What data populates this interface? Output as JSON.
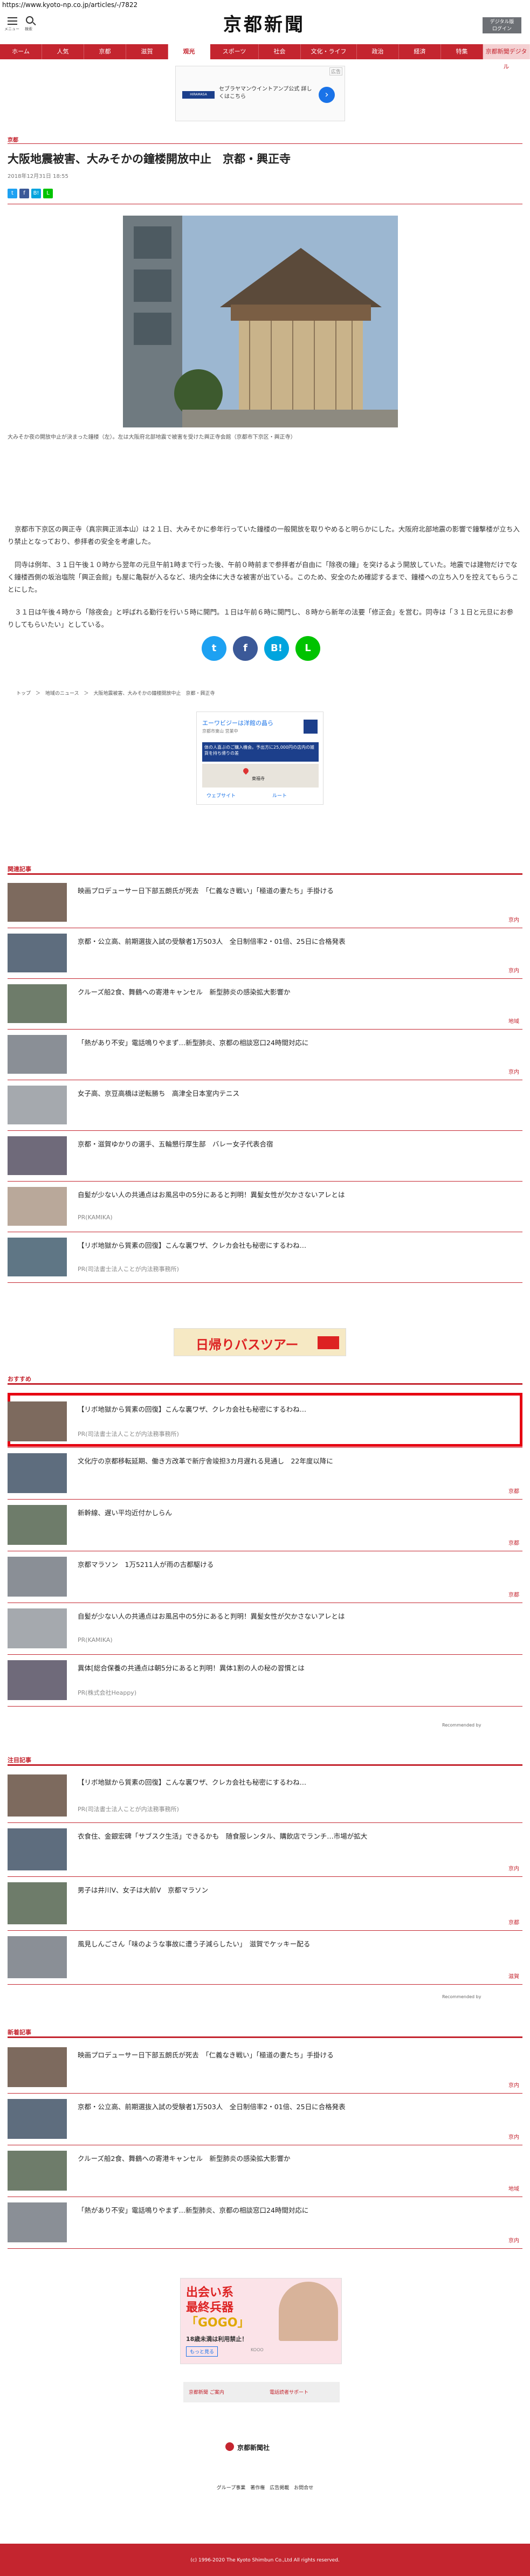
{
  "browser": {
    "url": "https://www.kyoto-np.co.jp/articles/-/7822"
  },
  "header": {
    "menu_label": "メニュー",
    "search_label": "検索",
    "logo": "京都新聞",
    "digital_button": "デジタル版\nログイン"
  },
  "nav": {
    "items": [
      {
        "label": "ホーム"
      },
      {
        "label": "人気"
      },
      {
        "label": "京都"
      },
      {
        "label": "滋賀"
      },
      {
        "label": "观光"
      },
      {
        "label": "スポーツ"
      },
      {
        "label": "社会"
      },
      {
        "label": "文化・ライフ"
      },
      {
        "label": "政治"
      },
      {
        "label": "経済"
      },
      {
        "label": "特集"
      },
      {
        "label": "京都新聞デジタル"
      }
    ]
  },
  "top_ad": {
    "tag": "広告",
    "brand": "HIRAMASA",
    "text": "セブラヤマンウイントアンプ公式 詳しくはこちら"
  },
  "article": {
    "section": "京都",
    "title": "大阪地震被害、大みそかの鐘楼開放中止　京都・興正寺",
    "date": "2018年12月31日 18:55",
    "caption": "大みそか夜の開放中止が決まった鐘楼（左）。左は大阪府北部地震で被害を受けた興正寺会館（京都市下京区・興正寺）",
    "paragraphs": [
      "京都市下京区の興正寺（真宗興正派本山）は２１日、大みそかに参年行っていた鐘楼の一般開放を取りやめると明らかにした。大阪府北部地震の影響で鐘撃楼が立ち入り禁止となっており、参拝者の安全を考慮した。",
      "同寺は例年、３１日午後１０時から翌年の元旦午前1時まで行った後、午前０時前まで参拝者が自由に「除夜の鐘」を突けるよう開放していた。地震では建物だけでなく鐘楼西側の坂治塩院「興正会館」も屋に亀裂が入るなど、境内全体に大きな被害が出ている。このため、安全のため確認するまで、鐘楼への立ち入りを控えてもらうことにした。",
      "３１日は午後４時から「除夜会」と呼ばれる勤行を行い５時に開門。１日は午前６時に開門し、８時から新年の法要「修正会」を営む。同寺は「３１日と元旦にお参りしてもらいたい」としている。"
    ],
    "breadcrumb": "トップ　＞　地域のニュース　＞　大阪地震被害、大みそかの鐘楼開放中止　京都・興正寺"
  },
  "share": {
    "twitter": "t",
    "facebook": "f",
    "hatena": "B!",
    "line": "L"
  },
  "mid_ad": {
    "title": "エーワビジーは洋館の晶ら",
    "subtitle": "京都市東山 営業中",
    "banner": "体の人喜ぶのご購入機会。予出方に25,000円の店内の雑貨を持ち帰りの差",
    "place": "東福寺",
    "btn1": "ウェブサイト",
    "btn2": "ルート"
  },
  "related": {
    "heading": "関連記事",
    "items": [
      {
        "title": "映画プロデューサー日下部五朗氏が死去　「仁義なき戦い」「極道の妻たち」手掛ける",
        "cat": "京内"
      },
      {
        "title": "京都・公立高、前期選抜入試の受験者1万503人　全日制倍率2・01倍、25日に合格発表",
        "cat": "京内"
      },
      {
        "title": "クルーズ船2食、舞鶴への寄港キャンセル　新型肺炎の感染拡大影響か",
        "cat": "地域"
      },
      {
        "title": "「熱があり不安」電話鳴りやまず…新型肺炎、京都の相談窓口24時間対応に",
        "cat": "京内"
      },
      {
        "title": "女子高、京豆高橋は逆転勝ち　高津全日本室内テニス",
        "cat": ""
      },
      {
        "title": "京都・滋賀ゆかりの選手、五輪懇行厚生部　バレー女子代表合宿",
        "cat": ""
      },
      {
        "title": "自髪が少ない人の共通点はお風呂中の5分にあると判明！異髪女性が欠かさないアレとは",
        "cat": "",
        "pr": "PR(KAMIKA)"
      },
      {
        "title": "【リボ地獄から質素の回復】こんな裏ワザ、クレカ会社も秘密にするわね…",
        "cat": "",
        "pr": "PR(司法書士法人ことが内法務事務所)"
      }
    ]
  },
  "banner_ad": {
    "text": "日帰りバスツアー"
  },
  "recommended": {
    "heading": "おすすめ",
    "items": [
      {
        "title": "【リボ地獄から質素の回復】こんな裏ワザ、クレカ会社も秘密にするわね…",
        "cat": "",
        "pr": "PR(司法書士法人ことが内法務事務所)"
      },
      {
        "title": "文化庁の京都移転延期、働き方改革で新庁舎竣担3カ月遅れる見通し　22年度以降に",
        "cat": "京都"
      },
      {
        "title": "新幹線、遅い平均近付かしらん",
        "cat": "京都"
      },
      {
        "title": "京都マラソン　1万5211人が雨の古都駆ける",
        "cat": "京都"
      },
      {
        "title": "自髪が少ない人の共通点はお風呂中の5分にあると判明！異髪女性が欠かさないアレとは",
        "cat": "",
        "pr": "PR(KAMIKA)"
      },
      {
        "title": "異体[総合保養の共通点は朝5分にあると判明！異体1割の人の秘の習慣とは",
        "cat": "",
        "pr": "PR(株式会社Heappy)"
      }
    ],
    "credit": "Recommended by"
  },
  "popular": {
    "heading": "注目記事",
    "items": [
      {
        "title": "【リボ地獄から質素の回復】こんな裏ワザ、クレカ会社も秘密にするわね…",
        "cat": "",
        "pr": "PR(司法書士法人ことが内法務事務所)"
      },
      {
        "title": "衣食住、金銀宏碑「サブスク生活」できるかも　随食服レンタル、購飲店でランチ…市場が拡大",
        "cat": "京内"
      },
      {
        "title": "男子は井川V、女子は大前V　京都マラソン",
        "cat": "京都"
      },
      {
        "title": "風見しんごさん「味のような事故に遭う子減らしたい」　滋賀でケッキー配る",
        "cat": "滋賀"
      }
    ],
    "credit": "Recommended by"
  },
  "latest": {
    "heading": "新着記事",
    "items": [
      {
        "title": "映画プロデューサー日下部五朗氏が死去　「仁義なき戦い」「極道の妻たち」手掛ける",
        "cat": "京内"
      },
      {
        "title": "京都・公立高、前期選抜入試の受験者1万503人　全日制倍率2・01倍、25日に合格発表",
        "cat": "京内"
      },
      {
        "title": "クルーズ船2食、舞鶴への寄港キャンセル　新型肺炎の感染拡大影響か",
        "cat": "地域"
      },
      {
        "title": "「熱があり不安」電話鳴りやまず…新型肺炎、京都の相談窓口24時間対応に",
        "cat": "京内"
      }
    ]
  },
  "bottom_ad": {
    "line1": "出会い系",
    "line2": "最終兵器",
    "line3": "「GOGO」",
    "note": "18歳未満は利用禁止！",
    "btn": "もっと見る",
    "tiny": "KOOO"
  },
  "footer_buttons": {
    "contact": "京都新聞 ご案内",
    "digital": "電話読者サポート"
  },
  "footer_logo": "京都新聞社",
  "footer_links": "グループ事業　著作権　広告掲載　お問合せ",
  "copyright": "(c) 1996-2020 The Kyoto Shimbun Co.,Ltd All rights reserved."
}
